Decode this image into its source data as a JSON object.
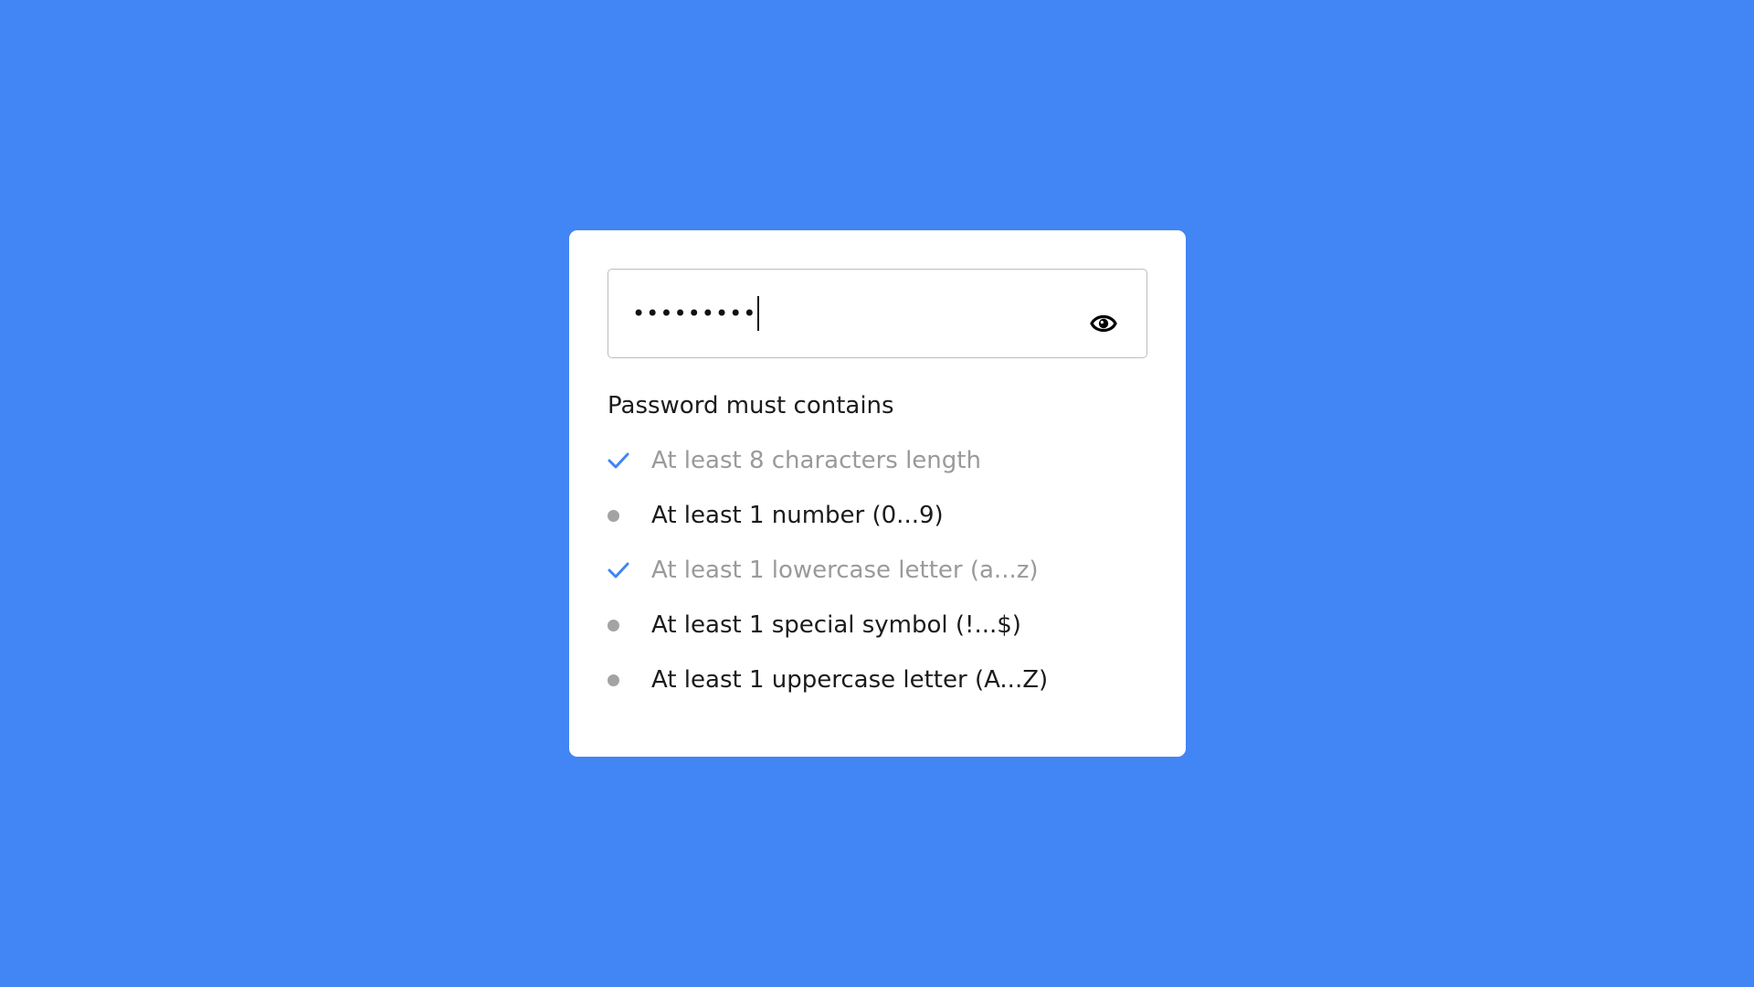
{
  "password_field": {
    "masked_value": "•••••••••"
  },
  "heading": "Password must contains",
  "requirements": [
    {
      "label": "At least 8 characters length",
      "met": true
    },
    {
      "label": "At least 1 number (0...9)",
      "met": false
    },
    {
      "label": "At least 1 lowercase letter (a...z)",
      "met": true
    },
    {
      "label": "At least 1 special symbol (!...$)",
      "met": false
    },
    {
      "label": "At least 1 uppercase letter (A...Z)",
      "met": false
    }
  ],
  "icons": {
    "visibility_toggle": "eye-icon",
    "met": "checkmark-icon",
    "unmet": "bullet-dot-icon"
  },
  "colors": {
    "background": "#4285f4",
    "card": "#ffffff",
    "check": "#4285f4",
    "met_text": "#9a9a9a",
    "unmet_text": "#1b1b1b",
    "dot": "#a3a3a3"
  }
}
